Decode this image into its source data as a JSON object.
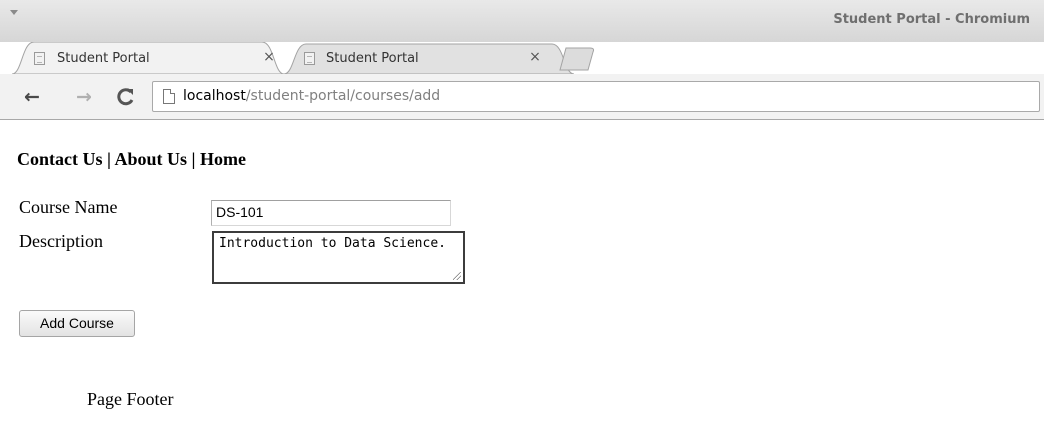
{
  "window": {
    "title": "Student Portal - Chromium"
  },
  "tabs": [
    {
      "title": "Student Portal",
      "close": "×",
      "active": true
    },
    {
      "title": "Student Portal",
      "close": "×",
      "active": false
    }
  ],
  "toolbar": {
    "back_glyph": "←",
    "forward_glyph": "→",
    "reload_glyph": "C",
    "url_host": "localhost",
    "url_path": "/student-portal/courses/add"
  },
  "page": {
    "nav": {
      "contact": "Contact Us",
      "separator": " | ",
      "about": "About Us",
      "home": "Home"
    },
    "form": {
      "course_name_label": "Course Name",
      "course_name_value": "DS-101",
      "description_label": "Description",
      "description_value": "Introduction to Data Science.",
      "submit_label": "Add Course"
    },
    "footer": "Page Footer"
  },
  "colors": {
    "titlebar_text": "#6f6f6f",
    "url_path": "#808080",
    "back_icon": "#4a4a4a",
    "forward_icon": "#b0b0b0"
  }
}
